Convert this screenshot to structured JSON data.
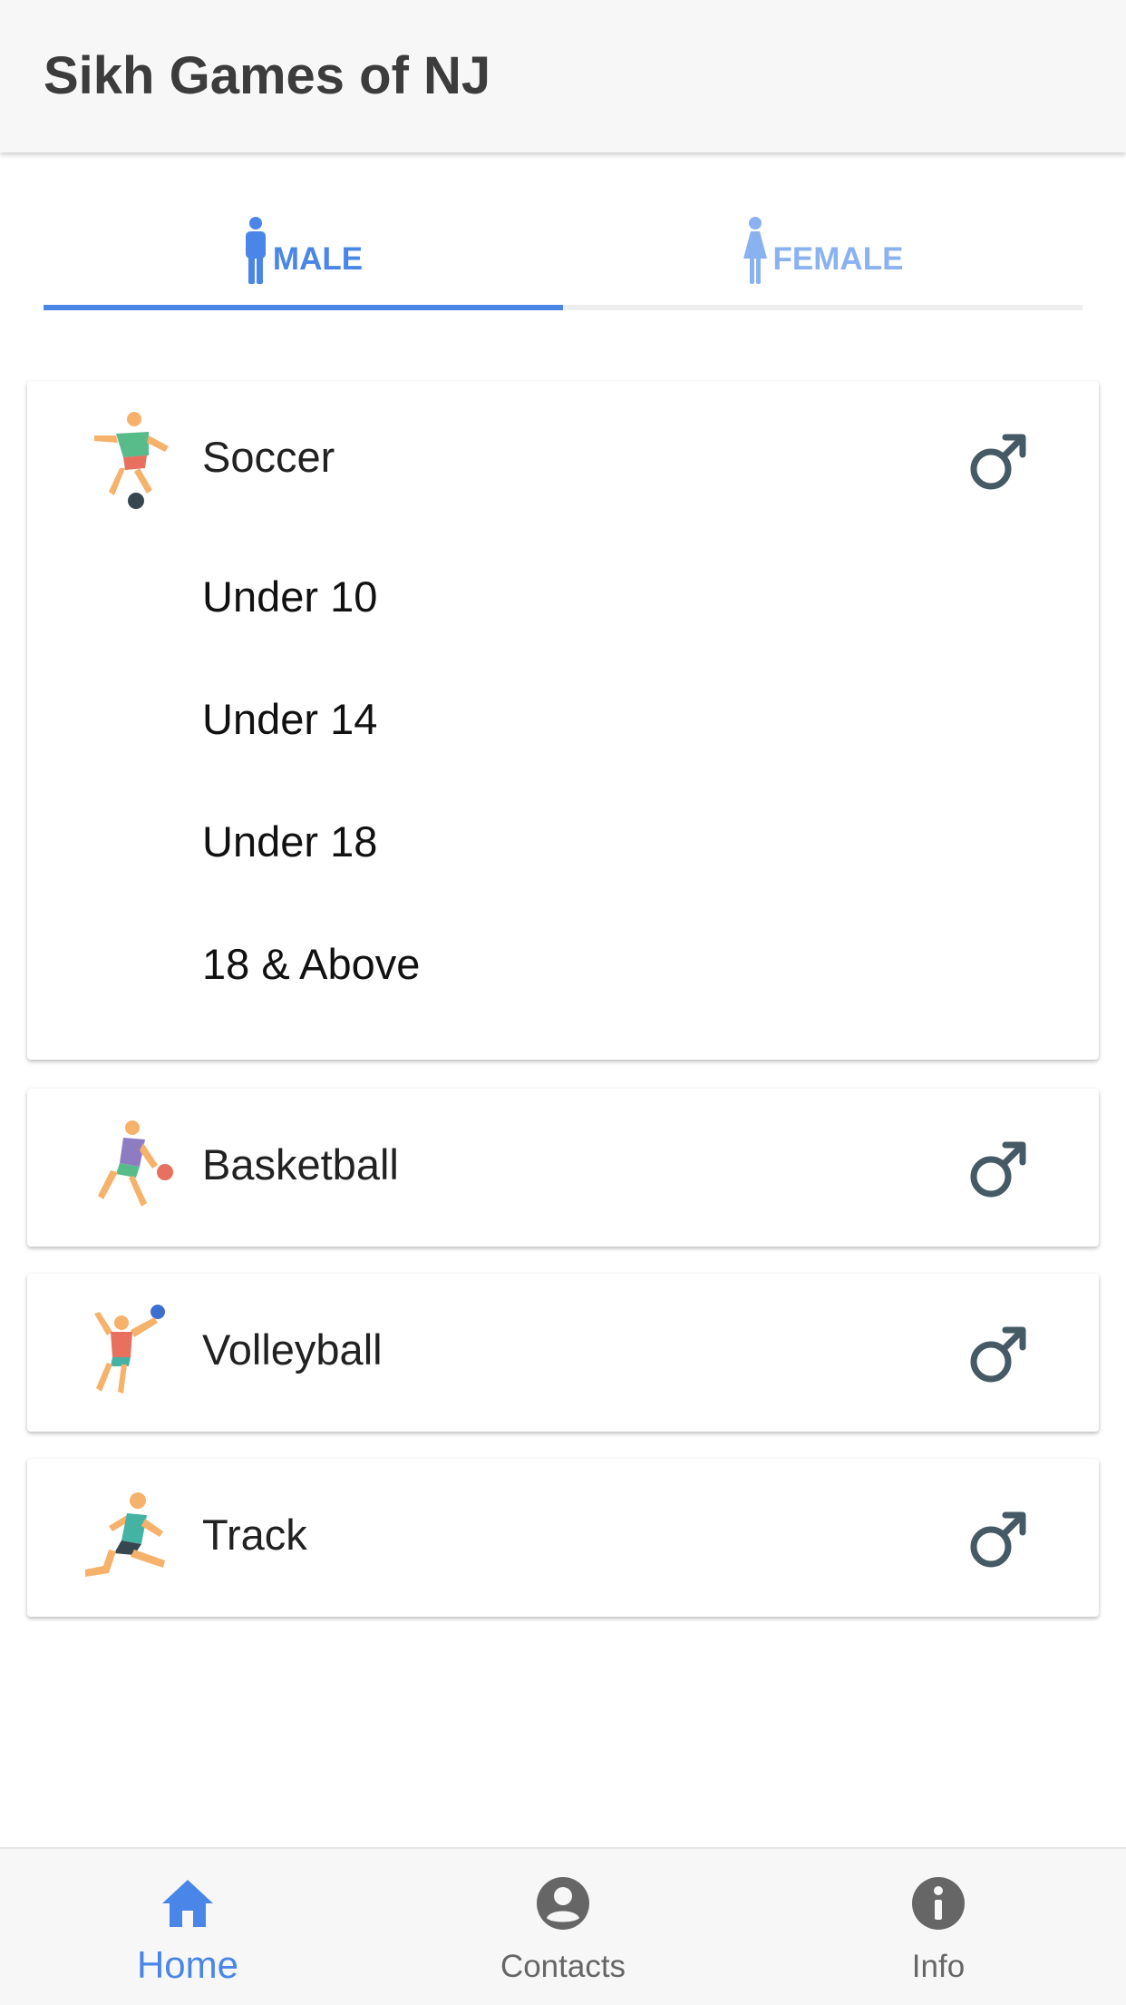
{
  "app": {
    "title": "Sikh Games of NJ"
  },
  "tabs": [
    {
      "label": "MALE",
      "icon": "male-person-icon",
      "selected": true
    },
    {
      "label": "FEMALE",
      "icon": "female-person-icon",
      "selected": false
    }
  ],
  "sports": [
    {
      "name": "Soccer",
      "icon": "soccer-player-icon",
      "gender_icon": "male-symbol-icon",
      "expanded": true,
      "divisions": [
        "Under 10",
        "Under 14",
        "Under 18",
        "18 & Above"
      ]
    },
    {
      "name": "Basketball",
      "icon": "basketball-player-icon",
      "gender_icon": "male-symbol-icon",
      "expanded": false
    },
    {
      "name": "Volleyball",
      "icon": "volleyball-player-icon",
      "gender_icon": "male-symbol-icon",
      "expanded": false
    },
    {
      "name": "Track",
      "icon": "runner-icon",
      "gender_icon": "male-symbol-icon",
      "expanded": false
    }
  ],
  "bottom_nav": [
    {
      "label": "Home",
      "icon": "home-icon",
      "active": true
    },
    {
      "label": "Contacts",
      "icon": "account-circle-icon",
      "active": false
    },
    {
      "label": "Info",
      "icon": "info-icon",
      "active": false
    }
  ],
  "colors": {
    "accent": "#4a86e8",
    "accent_light": "#8ab2f0",
    "appbar_bg": "#f7f7f7",
    "icon_dark": "#455a64"
  }
}
